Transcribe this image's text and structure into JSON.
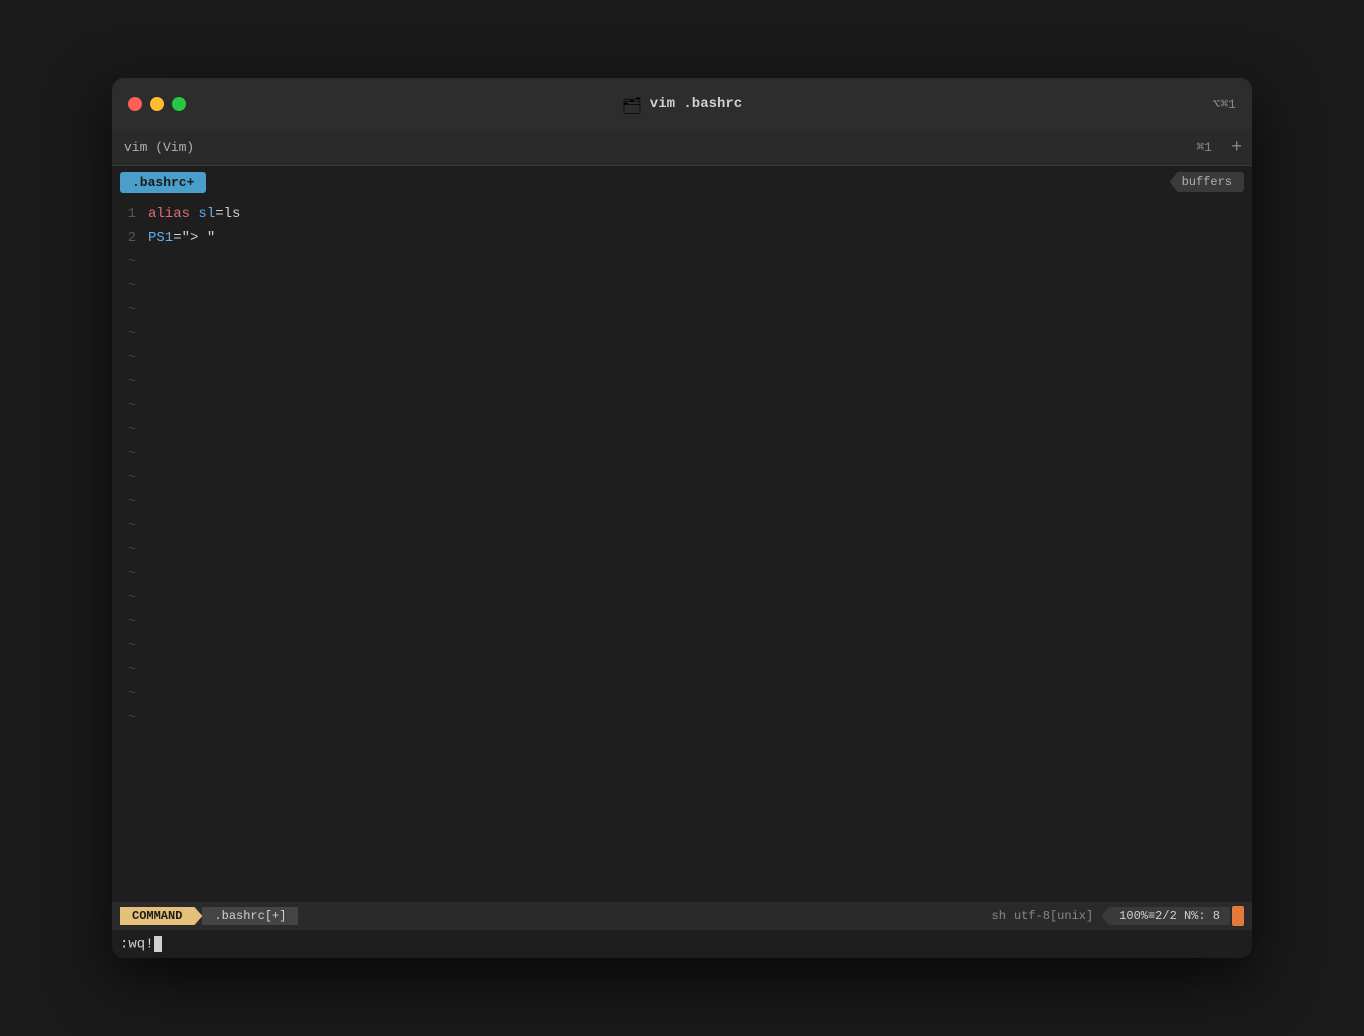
{
  "window": {
    "title": "vim .bashrc",
    "subtitle": "vim (Vim)",
    "shortcut_title": "⌥⌘1",
    "shortcut_tab": "⌘1"
  },
  "editor": {
    "file_tab": ".bashrc+",
    "buffers_label": "buffers"
  },
  "code": {
    "lines": [
      {
        "number": "1",
        "content": "alias sl=ls"
      },
      {
        "number": "2",
        "content": "PS1=\"> \""
      }
    ],
    "tildes": [
      "~",
      "~",
      "~",
      "~",
      "~",
      "~",
      "~",
      "~",
      "~",
      "~",
      "~",
      "~",
      "~",
      "~",
      "~",
      "~",
      "~",
      "~",
      "~",
      "~"
    ]
  },
  "statusbar": {
    "mode": "COMMAND",
    "filename": ".bashrc[+]",
    "filetype": "sh",
    "encoding": "utf-8[unix]",
    "position": "100%≡2/2  N%: 8"
  },
  "cmdline": {
    "text": ":wq!"
  },
  "icons": {
    "folder": "🗂",
    "close": "✕",
    "minimize": "−",
    "maximize": "+"
  }
}
